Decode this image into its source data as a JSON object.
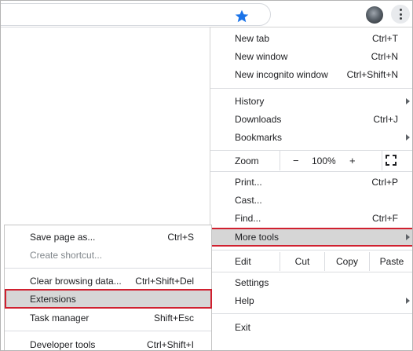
{
  "colors": {
    "accent_star": "#1a73e8",
    "highlight_bg": "#d6d6d6",
    "highlight_border": "#d0202f"
  },
  "toolbar": {
    "star_icon": "star-icon",
    "avatar_icon": "avatar",
    "menu_icon": "three-dots-vertical-icon"
  },
  "menu": {
    "new_tab": {
      "label": "New tab",
      "shortcut": "Ctrl+T"
    },
    "new_window": {
      "label": "New window",
      "shortcut": "Ctrl+N"
    },
    "new_incognito": {
      "label": "New incognito window",
      "shortcut": "Ctrl+Shift+N"
    },
    "history": {
      "label": "History"
    },
    "downloads": {
      "label": "Downloads",
      "shortcut": "Ctrl+J"
    },
    "bookmarks": {
      "label": "Bookmarks"
    },
    "zoom": {
      "label": "Zoom",
      "minus": "−",
      "value": "100%",
      "plus": "+"
    },
    "print": {
      "label": "Print...",
      "shortcut": "Ctrl+P"
    },
    "cast": {
      "label": "Cast..."
    },
    "find": {
      "label": "Find...",
      "shortcut": "Ctrl+F"
    },
    "more_tools": {
      "label": "More tools"
    },
    "edit": {
      "label": "Edit",
      "cut": "Cut",
      "copy": "Copy",
      "paste": "Paste"
    },
    "settings": {
      "label": "Settings"
    },
    "help": {
      "label": "Help"
    },
    "exit": {
      "label": "Exit"
    }
  },
  "submenu": {
    "save_page": {
      "label": "Save page as...",
      "shortcut": "Ctrl+S"
    },
    "create_shortcut": {
      "label": "Create shortcut..."
    },
    "clear_data": {
      "label": "Clear browsing data...",
      "shortcut": "Ctrl+Shift+Del"
    },
    "extensions": {
      "label": "Extensions"
    },
    "task_manager": {
      "label": "Task manager",
      "shortcut": "Shift+Esc"
    },
    "developer_tools": {
      "label": "Developer tools",
      "shortcut": "Ctrl+Shift+I"
    }
  }
}
